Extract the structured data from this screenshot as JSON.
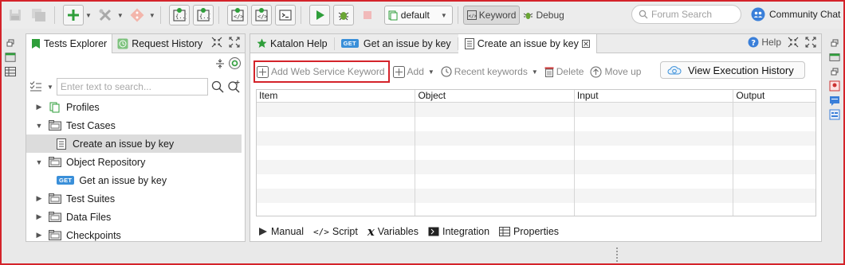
{
  "toolbar": {
    "profile_value": "default",
    "mode_keyword": "Keyword",
    "mode_debug": "Debug",
    "search_placeholder": "Forum Search",
    "community_label": "Community Chat"
  },
  "explorer": {
    "tab_tests": "Tests Explorer",
    "tab_history": "Request History",
    "filter_placeholder": "Enter text to search...",
    "tree": [
      {
        "label": "Profiles",
        "expanded": false
      },
      {
        "label": "Test Cases",
        "expanded": true
      },
      {
        "label": "Create an issue by key",
        "selected": true
      },
      {
        "label": "Object Repository",
        "expanded": true
      },
      {
        "label": "Get an issue by key",
        "badge": "GET"
      },
      {
        "label": "Test Suites",
        "expanded": false
      },
      {
        "label": "Data Files",
        "expanded": false
      },
      {
        "label": "Checkpoints",
        "expanded": false
      }
    ]
  },
  "editor": {
    "tabs": [
      {
        "label": "Katalon Help"
      },
      {
        "label": "Get an issue by key",
        "badge": "GET"
      },
      {
        "label": "Create an issue by key",
        "active": true
      }
    ],
    "help_label": "Help",
    "kw_toolbar": {
      "add_ws": "Add Web Service Keyword",
      "add": "Add",
      "recent": "Recent keywords",
      "delete": "Delete",
      "move_up": "Move up",
      "view_history": "View Execution History"
    },
    "columns": [
      "Item",
      "Object",
      "Input",
      "Output"
    ],
    "bottom_tabs": [
      "Manual",
      "Script",
      "Variables",
      "Integration",
      "Properties"
    ]
  },
  "colors": {
    "highlight": "#d4232a",
    "green": "#2e9e3a",
    "get_badge": "#3a8fd9"
  }
}
